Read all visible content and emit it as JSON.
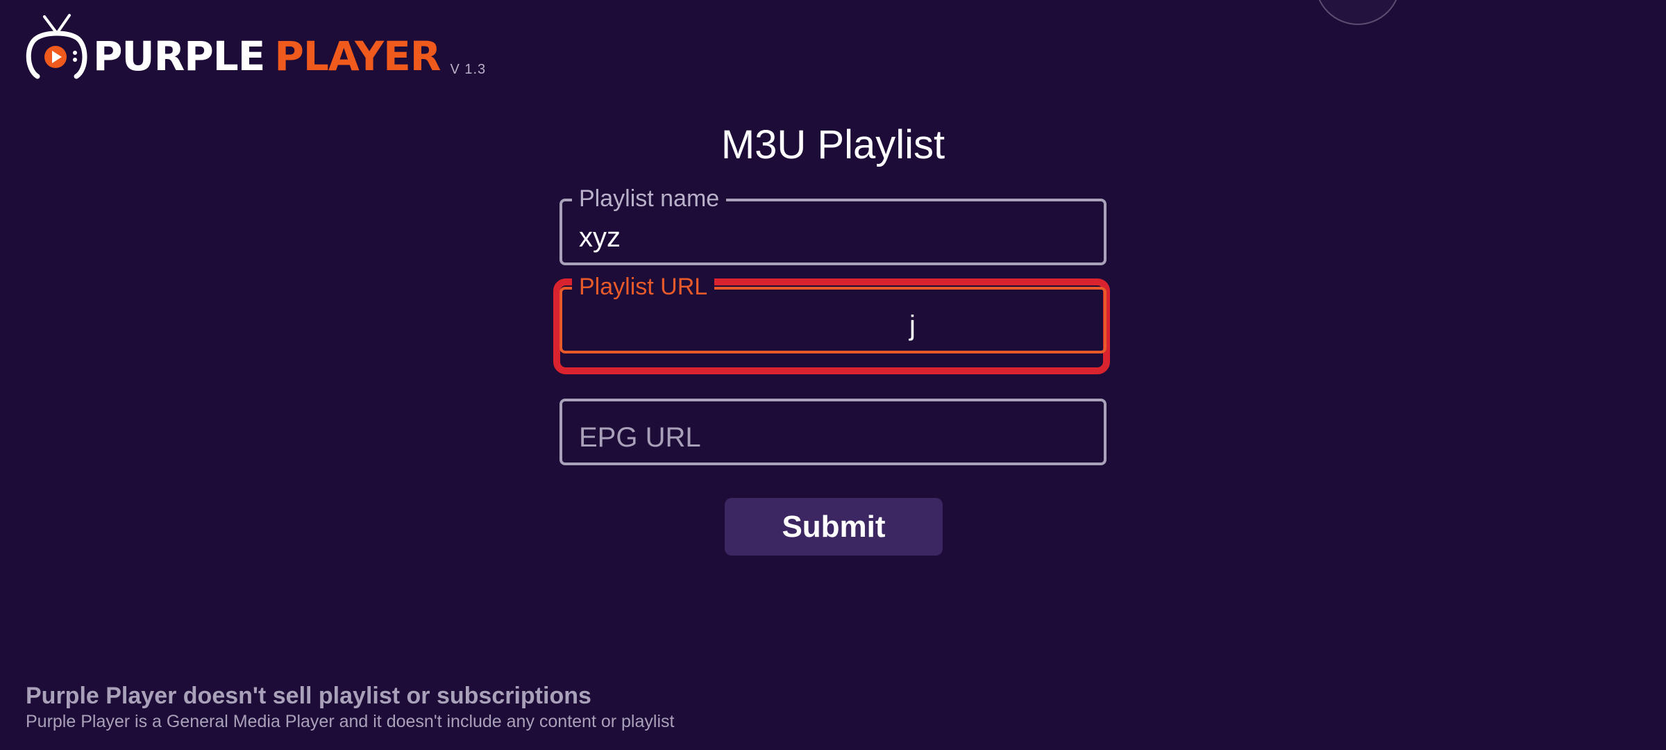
{
  "logo": {
    "word_1": "PURPLE",
    "word_2": "PLAYER",
    "version": "V 1.3",
    "icon": "tv-play-icon",
    "colors": {
      "primary": "#ffffff",
      "accent": "#f15a1d"
    }
  },
  "form": {
    "title": "M3U Playlist",
    "fields": [
      {
        "legend": "Playlist name",
        "value": "xyz",
        "placeholder": ""
      },
      {
        "legend": "Playlist URL",
        "value": "j",
        "placeholder": ""
      },
      {
        "legend": "",
        "value": "",
        "placeholder": "EPG URL"
      }
    ],
    "submit_label": "Submit"
  },
  "footer": {
    "title": "Purple Player doesn't sell playlist or subscriptions",
    "subtitle": "Purple Player is a General Media Player and it doesn't include any content or playlist"
  },
  "colors": {
    "background": "#1c0c37",
    "focus_ring": "#d9232e",
    "active_field": "#e85a2a",
    "button": "#3d2763"
  }
}
